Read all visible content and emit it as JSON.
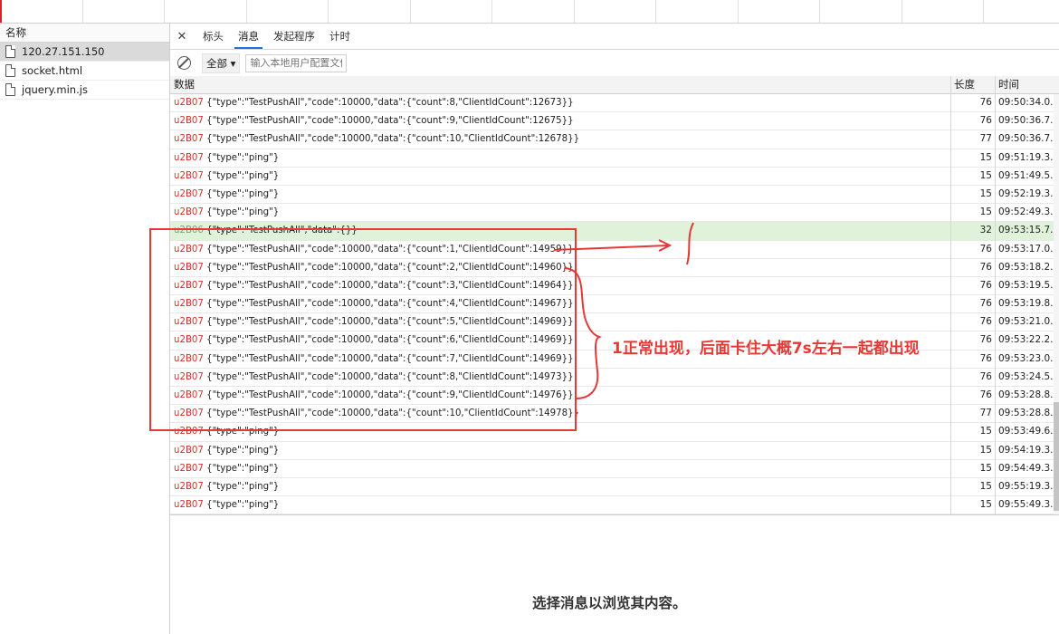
{
  "left_header": "名称",
  "requests": [
    {
      "name": "120.27.151.150"
    },
    {
      "name": "socket.html"
    },
    {
      "name": "jquery.min.js"
    }
  ],
  "tabs": [
    "标头",
    "消息",
    "发起程序",
    "计时"
  ],
  "filter": {
    "select_value": "全部",
    "input_placeholder": "输入本地用户配置文件"
  },
  "columns": {
    "data": "数据",
    "length": "长度",
    "time": "时间"
  },
  "messages": [
    {
      "tag": "u2B07",
      "text": "{\"type\":\"TestPushAll\",\"code\":10000,\"data\":{\"count\":8,\"ClientIdCount\":12673}}",
      "len": "76",
      "time": "09:50:34.0..."
    },
    {
      "tag": "u2B07",
      "text": "{\"type\":\"TestPushAll\",\"code\":10000,\"data\":{\"count\":9,\"ClientIdCount\":12675}}",
      "len": "76",
      "time": "09:50:36.7..."
    },
    {
      "tag": "u2B07",
      "text": "{\"type\":\"TestPushAll\",\"code\":10000,\"data\":{\"count\":10,\"ClientIdCount\":12678}}",
      "len": "77",
      "time": "09:50:36.7..."
    },
    {
      "tag": "u2B07",
      "text": "{\"type\":\"ping\"}",
      "len": "15",
      "time": "09:51:19.3..."
    },
    {
      "tag": "u2B07",
      "text": "{\"type\":\"ping\"}",
      "len": "15",
      "time": "09:51:49.5..."
    },
    {
      "tag": "u2B07",
      "text": "{\"type\":\"ping\"}",
      "len": "15",
      "time": "09:52:19.3..."
    },
    {
      "tag": "u2B07",
      "text": "{\"type\":\"ping\"}",
      "len": "15",
      "time": "09:52:49.3..."
    },
    {
      "tag": "u2B06",
      "text": "{\"type\":\"TestPushAll\",\"data\":{}}",
      "len": "32",
      "time": "09:53:15.7...",
      "highlight": true
    },
    {
      "tag": "u2B07",
      "text": "{\"type\":\"TestPushAll\",\"code\":10000,\"data\":{\"count\":1,\"ClientIdCount\":14959}}",
      "len": "76",
      "time": "09:53:17.0..."
    },
    {
      "tag": "u2B07",
      "text": "{\"type\":\"TestPushAll\",\"code\":10000,\"data\":{\"count\":2,\"ClientIdCount\":14960}}",
      "len": "76",
      "time": "09:53:18.2..."
    },
    {
      "tag": "u2B07",
      "text": "{\"type\":\"TestPushAll\",\"code\":10000,\"data\":{\"count\":3,\"ClientIdCount\":14964}}",
      "len": "76",
      "time": "09:53:19.5..."
    },
    {
      "tag": "u2B07",
      "text": "{\"type\":\"TestPushAll\",\"code\":10000,\"data\":{\"count\":4,\"ClientIdCount\":14967}}",
      "len": "76",
      "time": "09:53:19.8..."
    },
    {
      "tag": "u2B07",
      "text": "{\"type\":\"TestPushAll\",\"code\":10000,\"data\":{\"count\":5,\"ClientIdCount\":14969}}",
      "len": "76",
      "time": "09:53:21.0..."
    },
    {
      "tag": "u2B07",
      "text": "{\"type\":\"TestPushAll\",\"code\":10000,\"data\":{\"count\":6,\"ClientIdCount\":14969}}",
      "len": "76",
      "time": "09:53:22.2..."
    },
    {
      "tag": "u2B07",
      "text": "{\"type\":\"TestPushAll\",\"code\":10000,\"data\":{\"count\":7,\"ClientIdCount\":14969}}",
      "len": "76",
      "time": "09:53:23.0..."
    },
    {
      "tag": "u2B07",
      "text": "{\"type\":\"TestPushAll\",\"code\":10000,\"data\":{\"count\":8,\"ClientIdCount\":14973}}",
      "len": "76",
      "time": "09:53:24.5..."
    },
    {
      "tag": "u2B07",
      "text": "{\"type\":\"TestPushAll\",\"code\":10000,\"data\":{\"count\":9,\"ClientIdCount\":14976}}",
      "len": "76",
      "time": "09:53:28.8..."
    },
    {
      "tag": "u2B07",
      "text": "{\"type\":\"TestPushAll\",\"code\":10000,\"data\":{\"count\":10,\"ClientIdCount\":14978}}",
      "len": "77",
      "time": "09:53:28.8..."
    },
    {
      "tag": "u2B07",
      "text": "{\"type\":\"ping\"}",
      "len": "15",
      "time": "09:53:49.6..."
    },
    {
      "tag": "u2B07",
      "text": "{\"type\":\"ping\"}",
      "len": "15",
      "time": "09:54:19.3..."
    },
    {
      "tag": "u2B07",
      "text": "{\"type\":\"ping\"}",
      "len": "15",
      "time": "09:54:49.3..."
    },
    {
      "tag": "u2B07",
      "text": "{\"type\":\"ping\"}",
      "len": "15",
      "time": "09:55:19.3..."
    },
    {
      "tag": "u2B07",
      "text": "{\"type\":\"ping\"}",
      "len": "15",
      "time": "09:55:49.3..."
    }
  ],
  "empty_message": "选择消息以浏览其内容。",
  "annotation": {
    "text": "1正常出现，后面卡住大概7s左右一起都出现",
    "color": "#e53935"
  },
  "icons": {
    "close": "close-icon",
    "block": "block-icon",
    "file": "file-icon",
    "dropdown": "triangle-down-icon"
  }
}
